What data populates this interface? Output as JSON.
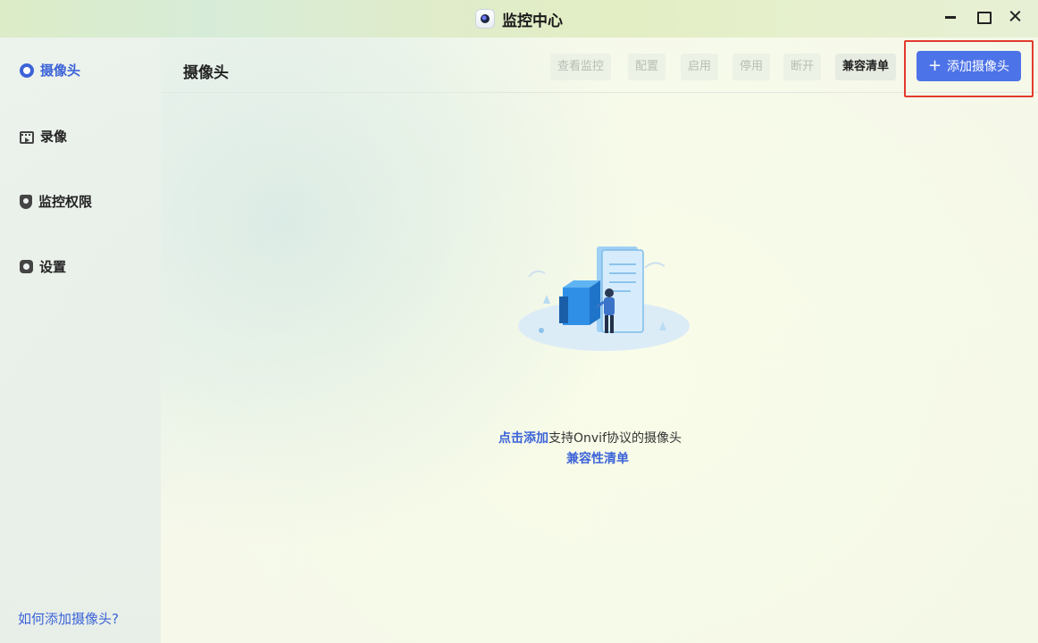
{
  "window": {
    "title": "监控中心",
    "icons": {
      "app": "camera-app-icon",
      "minimize": "minimize-icon",
      "maximize": "maximize-icon",
      "close": "close-icon"
    }
  },
  "sidebar": {
    "items": [
      {
        "label": "摄像头",
        "icon": "camera-icon",
        "active": true
      },
      {
        "label": "录像",
        "icon": "video-icon",
        "active": false
      },
      {
        "label": "监控权限",
        "icon": "shield-icon",
        "active": false
      },
      {
        "label": "设置",
        "icon": "gear-icon",
        "active": false
      }
    ],
    "help_link": "如何添加摄像头?"
  },
  "header": {
    "title": "摄像头",
    "toolbar": {
      "view": "查看监控",
      "config": "配置",
      "enable": "启用",
      "disable": "停用",
      "disconnect": "断开",
      "compat": "兼容清单",
      "add": "添加摄像头"
    }
  },
  "empty_state": {
    "click_add": "点击添加",
    "desc": "支持Onvif协议的摄像头",
    "compat_link": "兼容性清单"
  },
  "colors": {
    "accent": "#4d73e8",
    "link": "#3c63d8",
    "highlight": "#e23b2e"
  }
}
